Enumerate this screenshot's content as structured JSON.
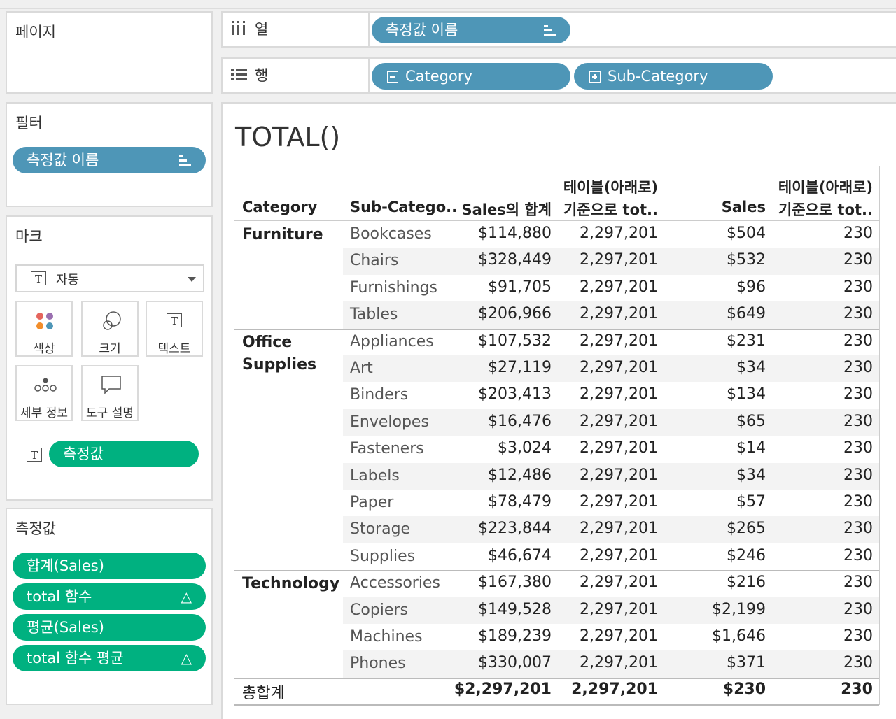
{
  "pages": {
    "title": "페이지"
  },
  "columns_shelf": {
    "label": "열",
    "pills": [
      {
        "label": "측정값 이름"
      }
    ]
  },
  "rows_shelf": {
    "label": "행",
    "pills": [
      {
        "label": "Category"
      },
      {
        "label": "Sub-Category"
      }
    ]
  },
  "filters": {
    "title": "필터",
    "pills": [
      {
        "label": "측정값 이름"
      }
    ]
  },
  "marks": {
    "title": "마크",
    "type": "자동",
    "cards": [
      "색상",
      "크기",
      "텍스트",
      "세부 정보",
      "도구 설명"
    ],
    "text_pill": "측정값"
  },
  "measure_values": {
    "title": "측정값",
    "pills": [
      "합계(Sales)",
      "total 함수",
      "평균(Sales)",
      "total 함수 평균"
    ]
  },
  "viz": {
    "title": "TOTAL()",
    "headers": {
      "category": "Category",
      "subcategory": "Sub-Catego..",
      "sum_sales": "Sales의 합계",
      "table_total_top": "테이블(아래로)",
      "table_total_bottom": "기준으로 tot..",
      "sales": "Sales",
      "table_total2_top": "테이블(아래로)",
      "table_total2_bottom": "기준으로 tot.."
    },
    "groups": [
      {
        "category": "Furniture",
        "rows": [
          {
            "sub": "Bookcases",
            "sum": "$114,880",
            "tot": "2,297,201",
            "avg": "$504",
            "tot2": "230"
          },
          {
            "sub": "Chairs",
            "sum": "$328,449",
            "tot": "2,297,201",
            "avg": "$532",
            "tot2": "230"
          },
          {
            "sub": "Furnishings",
            "sum": "$91,705",
            "tot": "2,297,201",
            "avg": "$96",
            "tot2": "230"
          },
          {
            "sub": "Tables",
            "sum": "$206,966",
            "tot": "2,297,201",
            "avg": "$649",
            "tot2": "230"
          }
        ]
      },
      {
        "category": "Office Supplies",
        "rows": [
          {
            "sub": "Appliances",
            "sum": "$107,532",
            "tot": "2,297,201",
            "avg": "$231",
            "tot2": "230"
          },
          {
            "sub": "Art",
            "sum": "$27,119",
            "tot": "2,297,201",
            "avg": "$34",
            "tot2": "230"
          },
          {
            "sub": "Binders",
            "sum": "$203,413",
            "tot": "2,297,201",
            "avg": "$134",
            "tot2": "230"
          },
          {
            "sub": "Envelopes",
            "sum": "$16,476",
            "tot": "2,297,201",
            "avg": "$65",
            "tot2": "230"
          },
          {
            "sub": "Fasteners",
            "sum": "$3,024",
            "tot": "2,297,201",
            "avg": "$14",
            "tot2": "230"
          },
          {
            "sub": "Labels",
            "sum": "$12,486",
            "tot": "2,297,201",
            "avg": "$34",
            "tot2": "230"
          },
          {
            "sub": "Paper",
            "sum": "$78,479",
            "tot": "2,297,201",
            "avg": "$57",
            "tot2": "230"
          },
          {
            "sub": "Storage",
            "sum": "$223,844",
            "tot": "2,297,201",
            "avg": "$265",
            "tot2": "230"
          },
          {
            "sub": "Supplies",
            "sum": "$46,674",
            "tot": "2,297,201",
            "avg": "$246",
            "tot2": "230"
          }
        ]
      },
      {
        "category": "Technology",
        "rows": [
          {
            "sub": "Accessories",
            "sum": "$167,380",
            "tot": "2,297,201",
            "avg": "$216",
            "tot2": "230"
          },
          {
            "sub": "Copiers",
            "sum": "$149,528",
            "tot": "2,297,201",
            "avg": "$2,199",
            "tot2": "230"
          },
          {
            "sub": "Machines",
            "sum": "$189,239",
            "tot": "2,297,201",
            "avg": "$1,646",
            "tot2": "230"
          },
          {
            "sub": "Phones",
            "sum": "$330,007",
            "tot": "2,297,201",
            "avg": "$371",
            "tot2": "230"
          }
        ]
      }
    ],
    "grand_total": {
      "label": "총합계",
      "sum": "$2,297,201",
      "tot": "2,297,201",
      "avg": "$230",
      "tot2": "230"
    }
  }
}
